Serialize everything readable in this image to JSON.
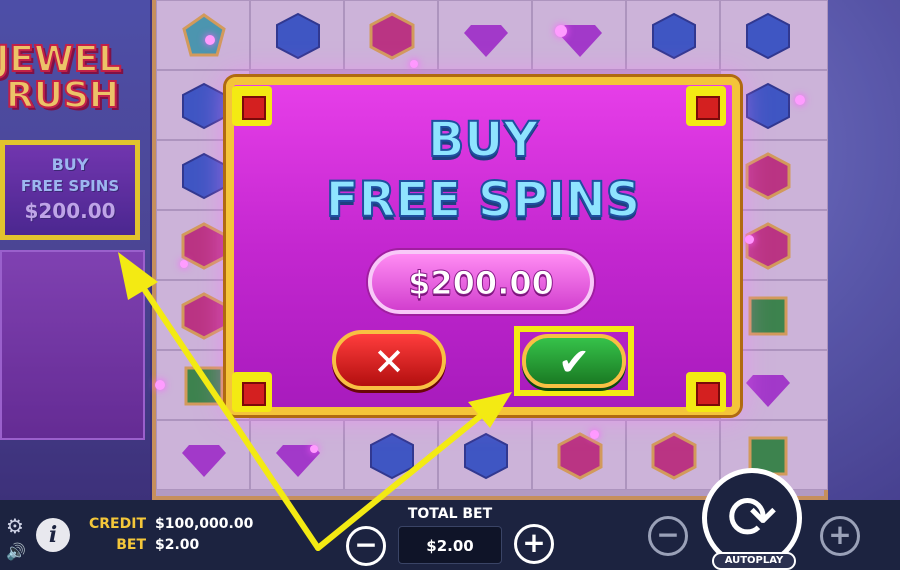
{
  "game": {
    "logo_line1": "JEWEL",
    "logo_line2": "RUSH"
  },
  "side_panel": {
    "line1": "BUY",
    "line2": "FREE SPINS",
    "price": "$200.00"
  },
  "dialog": {
    "title_line1": "BUY",
    "title_line2": "FREE SPINS",
    "price": "$200.00",
    "cancel_glyph": "✕",
    "confirm_glyph": "✔"
  },
  "bottom_bar": {
    "credit_label": "CREDIT",
    "credit_value": "$100,000.00",
    "bet_label": "BET",
    "bet_value": "$2.00",
    "info_glyph": "i",
    "gear_glyph": "⚙",
    "speaker_glyph": "🔊",
    "total_bet_label": "TOTAL BET",
    "total_bet_value": "$2.00",
    "minus_glyph": "−",
    "plus_glyph": "+",
    "spin_glyph": "⟳",
    "autoplay_label": "AUTOPLAY"
  },
  "colors": {
    "highlight": "#f3ea13",
    "dialog_bg": "#d62fd9",
    "confirm": "#2aa83a",
    "cancel": "#d41c1c",
    "title_text": "#8fe4ff"
  },
  "gems": [
    "blue-hexagon-gem",
    "purple-diamond-gem",
    "red-hexagon-gem",
    "green-square-gem",
    "teal-gem"
  ]
}
